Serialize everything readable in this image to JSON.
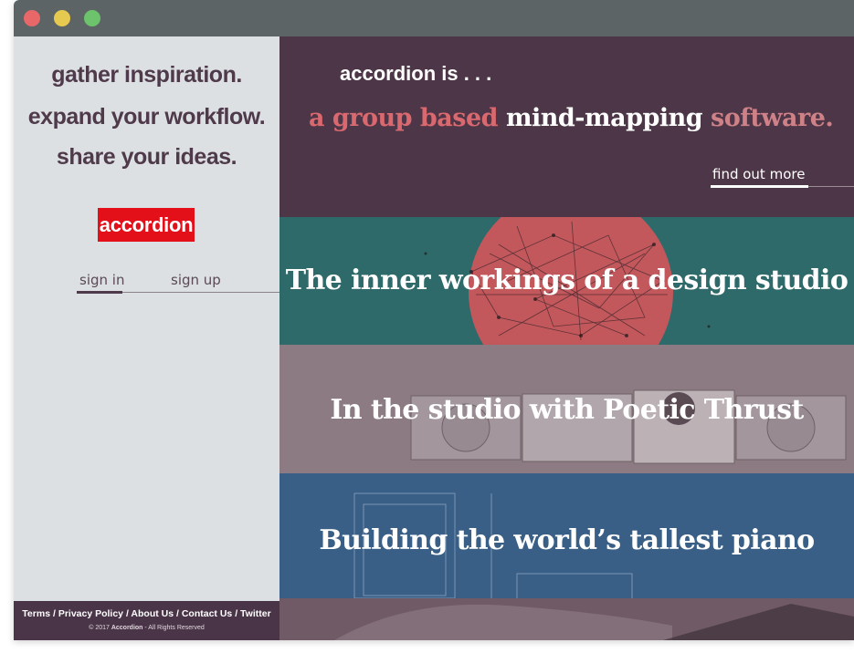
{
  "window": {
    "controls": {
      "close": "red-dot",
      "minimize": "yellow-dot",
      "zoom": "green-dot"
    }
  },
  "sidebar": {
    "taglines": [
      "gather inspiration.",
      "expand your workflow.",
      "share your ideas."
    ],
    "brand": "accordion",
    "auth": {
      "sign_in": "sign in",
      "sign_up": "sign up"
    }
  },
  "footer": {
    "links": [
      "Terms",
      "Privacy Policy",
      "About Us",
      "Contact Us",
      "Twitter"
    ],
    "separator": " / ",
    "copyright_prefix": "© 2017 ",
    "copyright_brand": "Accordion",
    "copyright_suffix": " - All Rights Reserved"
  },
  "hero": {
    "lead": "accordion is . . .",
    "title_part1": "a group based",
    "title_part2": " mind-mapping ",
    "title_part3": "software.",
    "cta": "find out more"
  },
  "articles": [
    {
      "title": "The inner workings of a design studio"
    },
    {
      "title": "In the studio with Poetic Thrust"
    },
    {
      "title": "Building the world’s tallest piano"
    }
  ],
  "colors": {
    "brand_red": "#e3101a",
    "plum": "#4d3647",
    "teal": "#2e6a69",
    "mauve": "#8c7b82",
    "blue": "#3a5f87",
    "sidebar_bg": "#dde0e2"
  }
}
